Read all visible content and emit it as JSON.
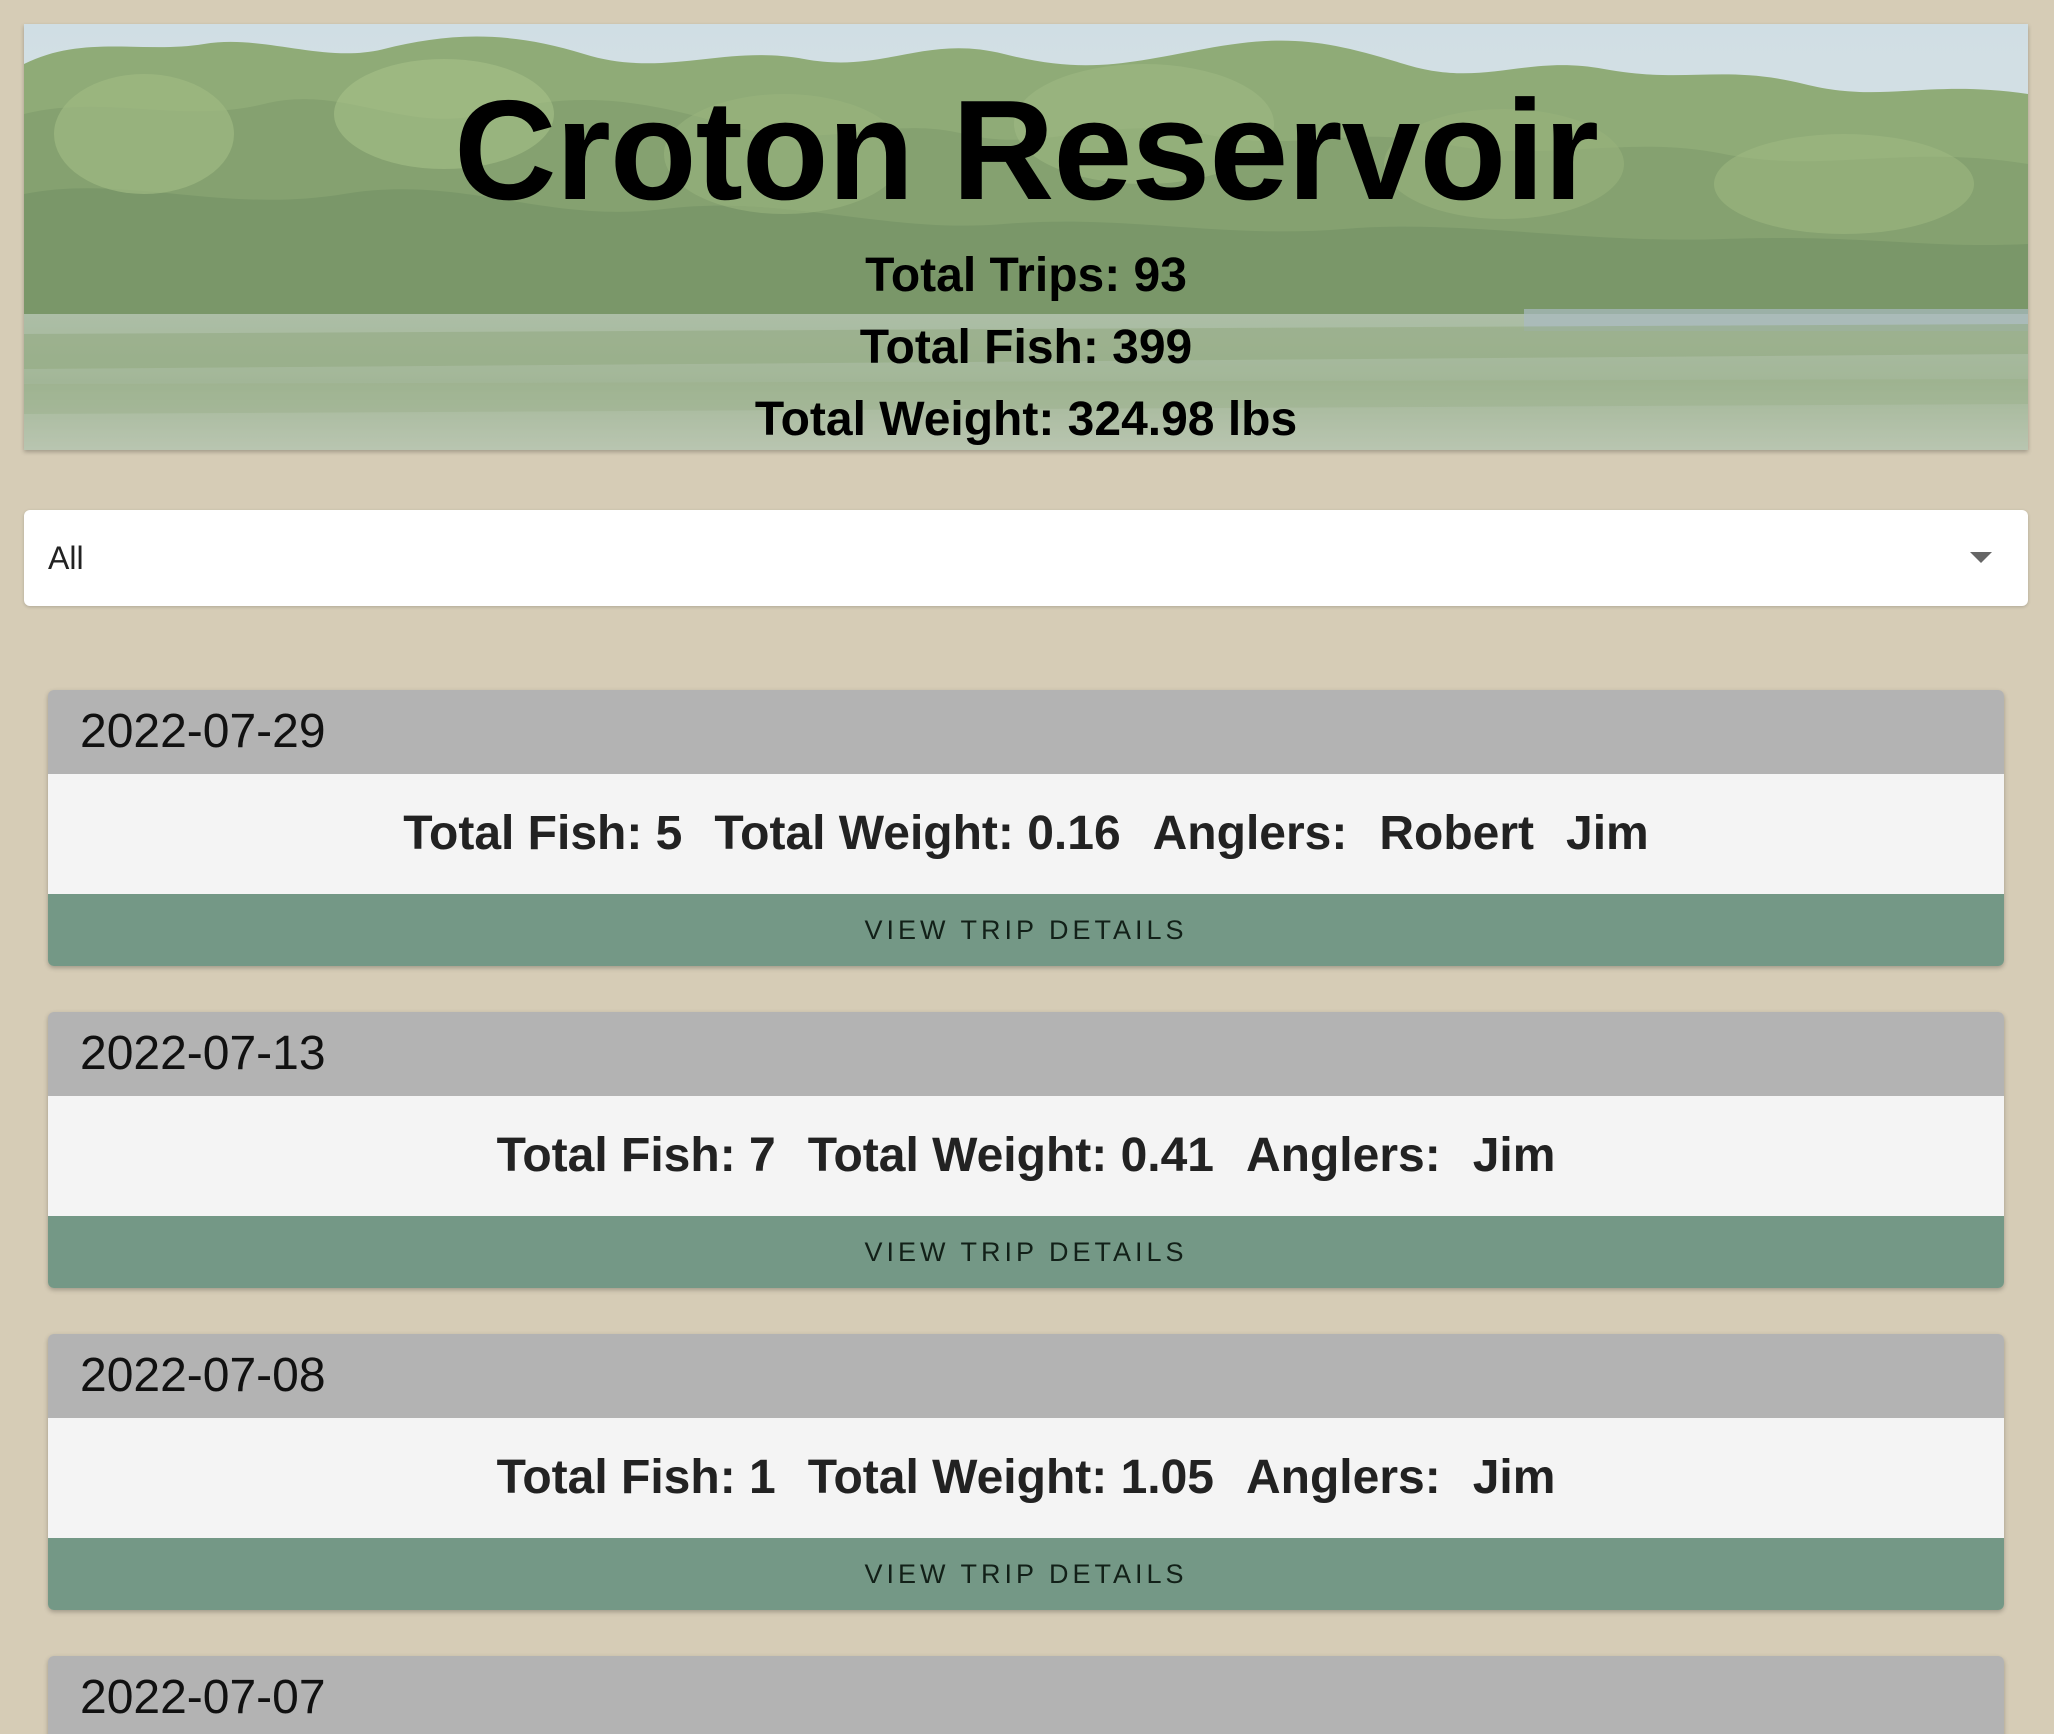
{
  "hero": {
    "title": "Croton Reservoir",
    "stats": [
      "Total Trips: 93",
      "Total Fish: 399",
      "Total Weight: 324.98 lbs"
    ]
  },
  "filter": {
    "selected": "All"
  },
  "trips": [
    {
      "date": "2022-07-29",
      "fish": "Total Fish: 5",
      "weight": "Total Weight: 0.16",
      "anglers_label": "Anglers:",
      "anglers": [
        "Robert",
        "Jim"
      ],
      "button": "VIEW TRIP DETAILS"
    },
    {
      "date": "2022-07-13",
      "fish": "Total Fish: 7",
      "weight": "Total Weight: 0.41",
      "anglers_label": "Anglers:",
      "anglers": [
        "Jim"
      ],
      "button": "VIEW TRIP DETAILS"
    },
    {
      "date": "2022-07-08",
      "fish": "Total Fish: 1",
      "weight": "Total Weight: 1.05",
      "anglers_label": "Anglers:",
      "anglers": [
        "Jim"
      ],
      "button": "VIEW TRIP DETAILS"
    },
    {
      "date": "2022-07-07"
    }
  ],
  "colors": {
    "page_bg": "#d6ccb6",
    "card_header": "#b3b3b3",
    "card_body": "#f4f4f4",
    "button": "#749886"
  }
}
